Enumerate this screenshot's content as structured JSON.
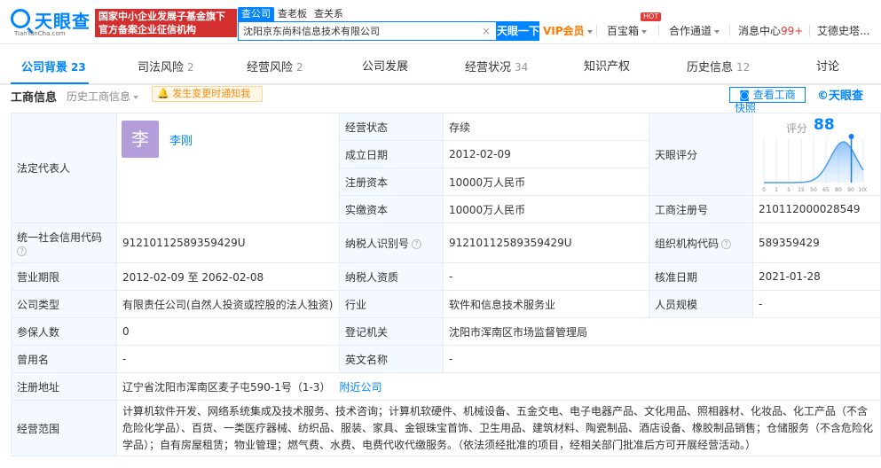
{
  "header": {
    "logo_name": "天眼查",
    "logo_sub": "TianYanCha.com",
    "promo_line1": "国家中小企业发展子基金旗下",
    "promo_line2": "官方备案企业征信机构",
    "search_tabs": [
      "查公司",
      "查老板",
      "查关系"
    ],
    "search_value": "沈阳京东尚科信息技术有限公司",
    "search_button": "天眼一下",
    "vip_label": "VIP会员",
    "hot_badge": "HOT",
    "baibaoxiang": "百宝箱",
    "hezuo": "合作通道",
    "message_center": "消息中心",
    "message_count": "99+",
    "user_name": "艾德史塔..."
  },
  "tabs": [
    {
      "label": "公司背景",
      "count": "23",
      "active": true
    },
    {
      "label": "司法风险",
      "count": "2",
      "active": false
    },
    {
      "label": "经营风险",
      "count": "2",
      "active": false
    },
    {
      "label": "公司发展",
      "count": "",
      "active": false
    },
    {
      "label": "经营状况",
      "count": "34",
      "active": false
    },
    {
      "label": "知识产权",
      "count": "",
      "active": false
    },
    {
      "label": "历史信息",
      "count": "12",
      "active": false
    },
    {
      "label": "讨论",
      "count": "",
      "active": false
    }
  ],
  "section": {
    "title": "工商信息",
    "history": "历史工商信息",
    "notify": "发生变更时通知我",
    "snapshot_btn": "查看工商",
    "snapshot_wrap": "快照",
    "brand": "天眼查"
  },
  "info": {
    "legal_rep_label": "法定代表人",
    "avatar_char": "李",
    "legal_rep_name": "李刚",
    "status_label": "经营状态",
    "status_value": "存续",
    "score_label": "天眼评分",
    "score_text": "评分",
    "score_value": "88",
    "est_date_label": "成立日期",
    "est_date_value": "2012-02-09",
    "reg_capital_label": "注册资本",
    "reg_capital_value": "10000万人民币",
    "paid_capital_label": "实缴资本",
    "paid_capital_value": "10000万人民币",
    "reg_no_label": "工商注册号",
    "reg_no_value": "210112000028549",
    "credit_code_label": "统一社会信用代码",
    "credit_code_value": "91210112589359429U",
    "taxpayer_id_label": "纳税人识别号",
    "taxpayer_id_value": "91210112589359429U",
    "org_code_label": "组织机构代码",
    "org_code_value": "589359429",
    "term_label": "营业期限",
    "term_value": "2012-02-09 至 2062-02-08",
    "taxpayer_qual_label": "纳税人资质",
    "taxpayer_qual_value": "-",
    "approval_date_label": "核准日期",
    "approval_date_value": "2021-01-28",
    "company_type_label": "公司类型",
    "company_type_value": "有限责任公司(自然人投资或控股的法人独资)",
    "industry_label": "行业",
    "industry_value": "软件和信息技术服务业",
    "staff_size_label": "人员规模",
    "staff_size_value": "-",
    "insured_label": "参保人数",
    "insured_value": "0",
    "reg_authority_label": "登记机关",
    "reg_authority_value": "沈阳市浑南区市场监督管理局",
    "former_name_label": "曾用名",
    "former_name_value": "-",
    "english_name_label": "英文名称",
    "english_name_value": "-",
    "address_label": "注册地址",
    "address_value": "辽宁省沈阳市浑南区麦子屯590-1号（1-3）",
    "address_link": "附近公司",
    "scope_label": "经营范围",
    "scope_value": "计算机软件开发、网络系统集成及技术服务、技术咨询；计算机软硬件、机械设备、五金交电、电子电器产品、文化用品、照相器材、化妆品、化工产品（不含危险化学品）、百货、一类医疗器械、纺织品、服装、家具、金银珠宝首饰、卫生用品、建筑材料、陶瓷制品、酒店设备、橡胶制品销售；仓储服务（不含危险化学品）；自有房屋租赁；物业管理；燃气费、水费、电费代收代缴服务。（依法须经批准的项目，经相关部门批准后方可开展经营活动。）"
  },
  "score_chart": {
    "ticks": [
      "0",
      "1",
      "5",
      "15",
      "50",
      "65",
      "80",
      "90",
      "100"
    ],
    "score_fraction": 0.88
  }
}
